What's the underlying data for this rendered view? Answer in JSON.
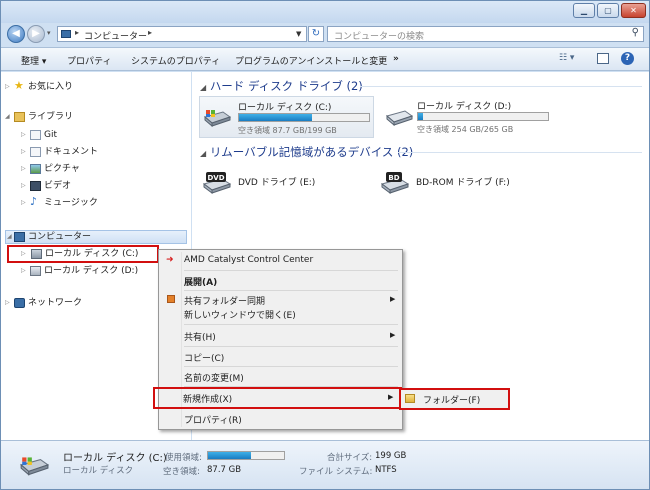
{
  "address": {
    "path": "コンピューター",
    "search_placeholder": "コンピューターの検索"
  },
  "toolbar": {
    "organize": "整理 ▾",
    "properties": "プロパティ",
    "system_properties": "システムのプロパティ",
    "uninstall": "プログラムのアンインストールと変更",
    "more": "»"
  },
  "nav": {
    "favorites": "お気に入り",
    "libraries": "ライブラリ",
    "library_items": [
      "Git",
      "ドキュメント",
      "ピクチャ",
      "ビデオ",
      "ミュージック"
    ],
    "computer": "コンピューター",
    "drive_c": "ローカル ディスク (C:)",
    "drive_d": "ローカル ディスク (D:)",
    "network": "ネットワーク"
  },
  "content": {
    "hdd_header": "ハード ディスク ドライブ (2)",
    "removable_header": "リムーバブル記憶域があるデバイス (2)",
    "drives": [
      {
        "name": "ローカル ディスク (C:)",
        "free": "空き領域 87.7 GB/199 GB",
        "used_fraction": 0.56
      },
      {
        "name": "ローカル ディスク (D:)",
        "free": "空き領域 254 GB/265 GB",
        "used_fraction": 0.04
      }
    ],
    "removable": [
      {
        "name": "DVD ドライブ (E:)",
        "icon_label": "DVD"
      },
      {
        "name": "BD-ROM ドライブ (F:)",
        "icon_label": "BD"
      }
    ]
  },
  "context_menu": {
    "amd": "AMD Catalyst Control Center",
    "expand": "展開(A)",
    "sync": "共有フォルダー同期",
    "open_new": "新しいウィンドウで開く(E)",
    "share": "共有(H)",
    "copy": "コピー(C)",
    "rename": "名前の変更(M)",
    "new": "新規作成(X)",
    "properties": "プロパティ(R)",
    "submenu_folder": "フォルダー(F)"
  },
  "details": {
    "title": "ローカル ディスク (C:)",
    "subtitle": "ローカル ディスク",
    "used_label": "使用領域:",
    "used_fraction": 0.56,
    "free_label": "空き領域:",
    "free_value": "87.7 GB",
    "total_label": "合計サイズ:",
    "total_value": "199 GB",
    "fs_label": "ファイル システム:",
    "fs_value": "NTFS"
  },
  "colors": {
    "accent_red": "#d20f0f",
    "group_header": "#1e3c8c",
    "bar_fill": "#1a7cc2"
  }
}
